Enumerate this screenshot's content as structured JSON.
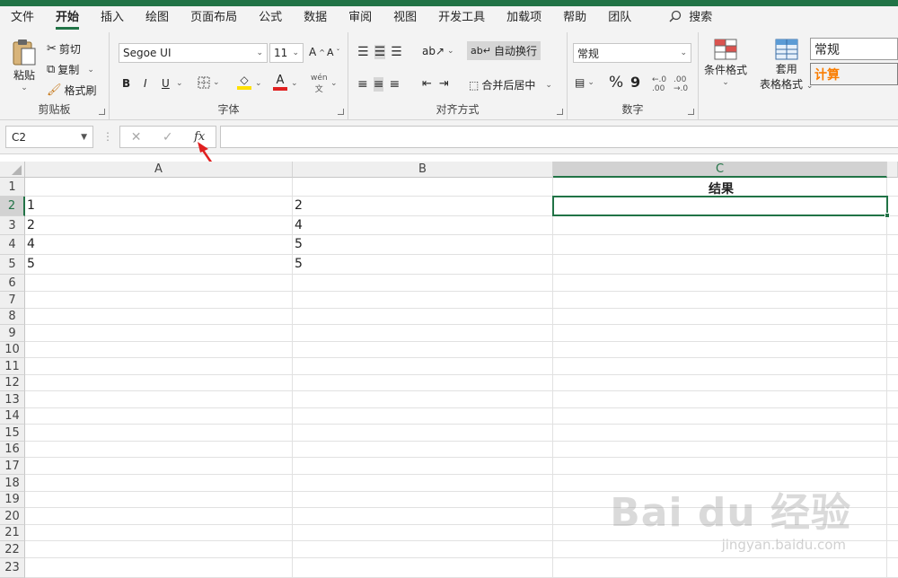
{
  "tabs": [
    "文件",
    "开始",
    "插入",
    "绘图",
    "页面布局",
    "公式",
    "数据",
    "审阅",
    "视图",
    "开发工具",
    "加载项",
    "帮助",
    "团队"
  ],
  "search_label": "搜索",
  "clipboard": {
    "paste": "粘贴",
    "cut": "剪切",
    "copy": "复制",
    "format_painter": "格式刷",
    "label": "剪贴板"
  },
  "font": {
    "name": "Segoe UI",
    "size": "11",
    "label": "字体",
    "bold": "B",
    "italic": "I",
    "underline": "U",
    "grow": "A",
    "shrink": "A"
  },
  "alignment": {
    "wrap_text": "自动换行",
    "merge_center": "合并后居中",
    "label": "对齐方式"
  },
  "number": {
    "format": "常规",
    "label": "数字",
    "percent": "%",
    "comma": "9"
  },
  "styles": {
    "conditional": "条件格式",
    "table_line1": "套用",
    "table_line2": "表格格式",
    "style_normal": "常规",
    "style_calc": "计算"
  },
  "formula_bar": {
    "name_box": "C2",
    "fx": "fx",
    "value": ""
  },
  "columns": [
    "A",
    "B",
    "C"
  ],
  "rows": [
    "1",
    "2",
    "3",
    "4",
    "5",
    "6",
    "7",
    "8",
    "9",
    "10",
    "11",
    "12",
    "13",
    "14",
    "15",
    "16",
    "17",
    "18",
    "19",
    "20",
    "21",
    "22",
    "23"
  ],
  "cells": {
    "c1": "结果",
    "a2": "1",
    "b2": "2",
    "a3": "2",
    "b3": "4",
    "a4": "4",
    "b4": "5",
    "a5": "5",
    "b5": "5"
  },
  "colors": {
    "accent": "#217346",
    "arrow": "#e02020",
    "font_color": "#e02020",
    "fill_color": "#ffe000",
    "calc_style": "#fa7d00"
  },
  "watermark": {
    "main": "Bai du 经验",
    "sub": "jingyan.baidu.com"
  }
}
